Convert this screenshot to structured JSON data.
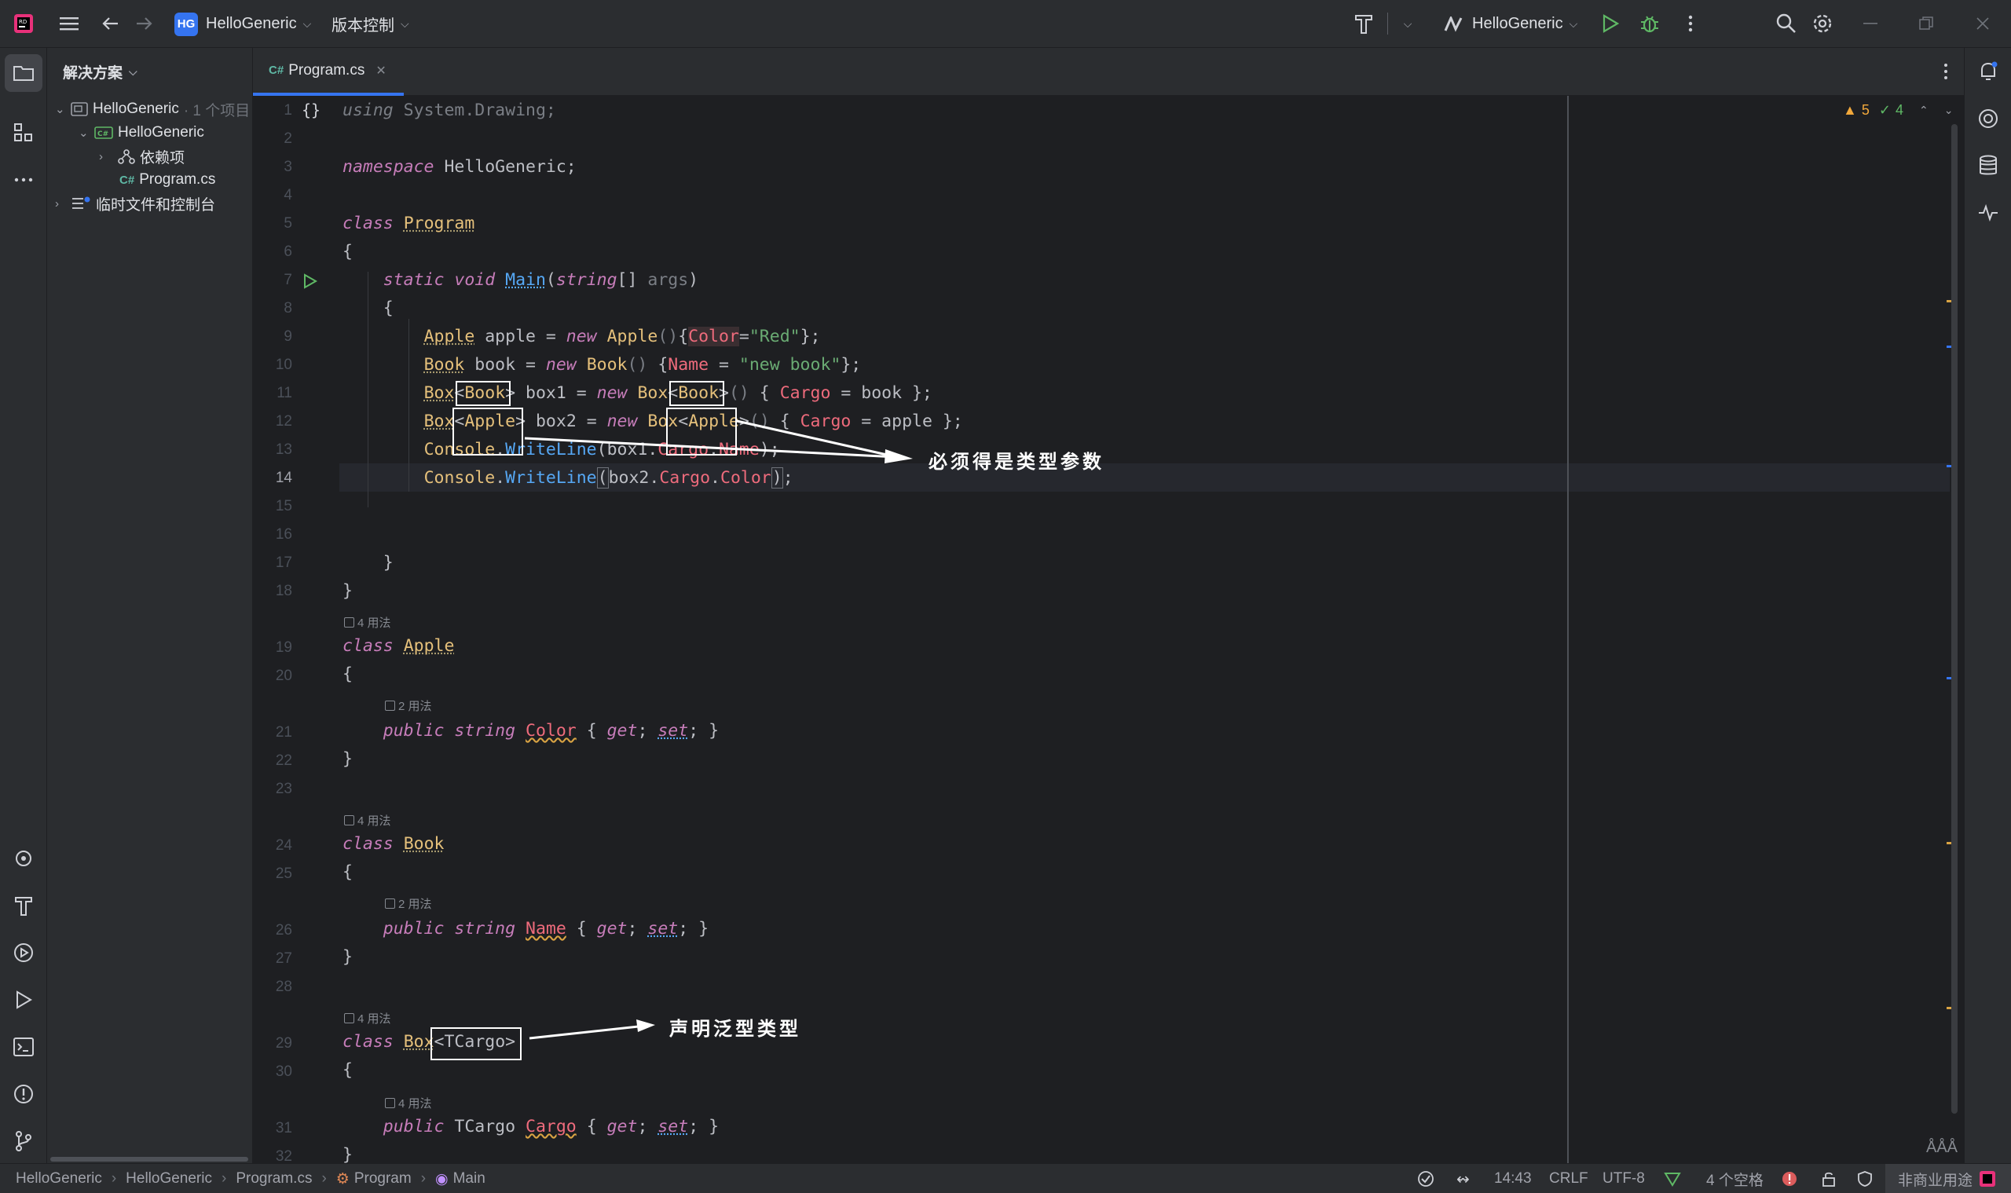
{
  "titlebar": {
    "project_name": "HelloGeneric",
    "project_badge": "HG",
    "vcs_menu": "版本控制",
    "run_config": "HelloGeneric"
  },
  "project_panel": {
    "title": "解决方案",
    "items": [
      {
        "label": "HelloGeneric",
        "suffix": "· 1 个项目"
      },
      {
        "label": "HelloGeneric"
      },
      {
        "label": "依赖项"
      },
      {
        "label": "Program.cs",
        "tag": "C#"
      },
      {
        "label": "临时文件和控制台"
      }
    ]
  },
  "tabs": [
    {
      "label": "Program.cs",
      "tag": "C#"
    }
  ],
  "editor": {
    "inspection": {
      "warnings": "5",
      "ok": "4"
    },
    "line_numbers": [
      "1",
      "2",
      "3",
      "4",
      "5",
      "6",
      "7",
      "8",
      "9",
      "10",
      "11",
      "12",
      "13",
      "14",
      "15",
      "16",
      "17",
      "18",
      "19",
      "20",
      "21",
      "22",
      "23",
      "24",
      "25",
      "26",
      "27",
      "28",
      "29",
      "30",
      "31",
      "32"
    ],
    "hints": {
      "usages4": "4 用法",
      "usages2": "2 用法"
    },
    "annotations": {
      "type_arg": "必须得是类型参数",
      "generic_decl": "声明泛型类型"
    },
    "fold_marker": "{}"
  },
  "statusbar": {
    "breadcrumb": [
      "HelloGeneric",
      "HelloGeneric",
      "Program.cs",
      "Program",
      "Main"
    ],
    "position": "14:43",
    "line_ending": "CRLF",
    "encoding": "UTF-8",
    "indent": "4 个空格",
    "license": "非商业用途"
  }
}
